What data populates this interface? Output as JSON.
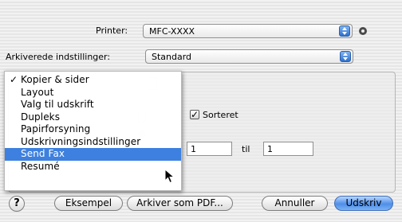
{
  "printer": {
    "label": "Printer:",
    "value": "MFC-XXXX"
  },
  "presets": {
    "label": "Arkiverede indstillinger:",
    "value": "Standard"
  },
  "menu": {
    "items": [
      {
        "label": "Kopier & sider",
        "checked": true
      },
      {
        "label": "Layout"
      },
      {
        "label": "Valg til udskrift"
      },
      {
        "label": "Dupleks"
      },
      {
        "label": "Papirforsyning"
      },
      {
        "label": "Udskrivningsindstillinger"
      },
      {
        "label": "Send Fax",
        "selected": true
      },
      {
        "label": "Resumé"
      }
    ],
    "checkmark": "✓"
  },
  "copies": {
    "collated_label": "Sorteret",
    "collated": true
  },
  "pages": {
    "from_value": "1",
    "to_label": "til",
    "to_value": "1"
  },
  "buttons": {
    "help": "?",
    "preview": "Eksempel",
    "save_pdf": "Arkiver som PDF...",
    "cancel": "Annuller",
    "print": "Udskriv"
  },
  "colors": {
    "accent": "#3d80df",
    "default_button": "#4f8ee8"
  },
  "icons": {
    "info": "info-icon",
    "cursor": "arrow-cursor-icon"
  }
}
